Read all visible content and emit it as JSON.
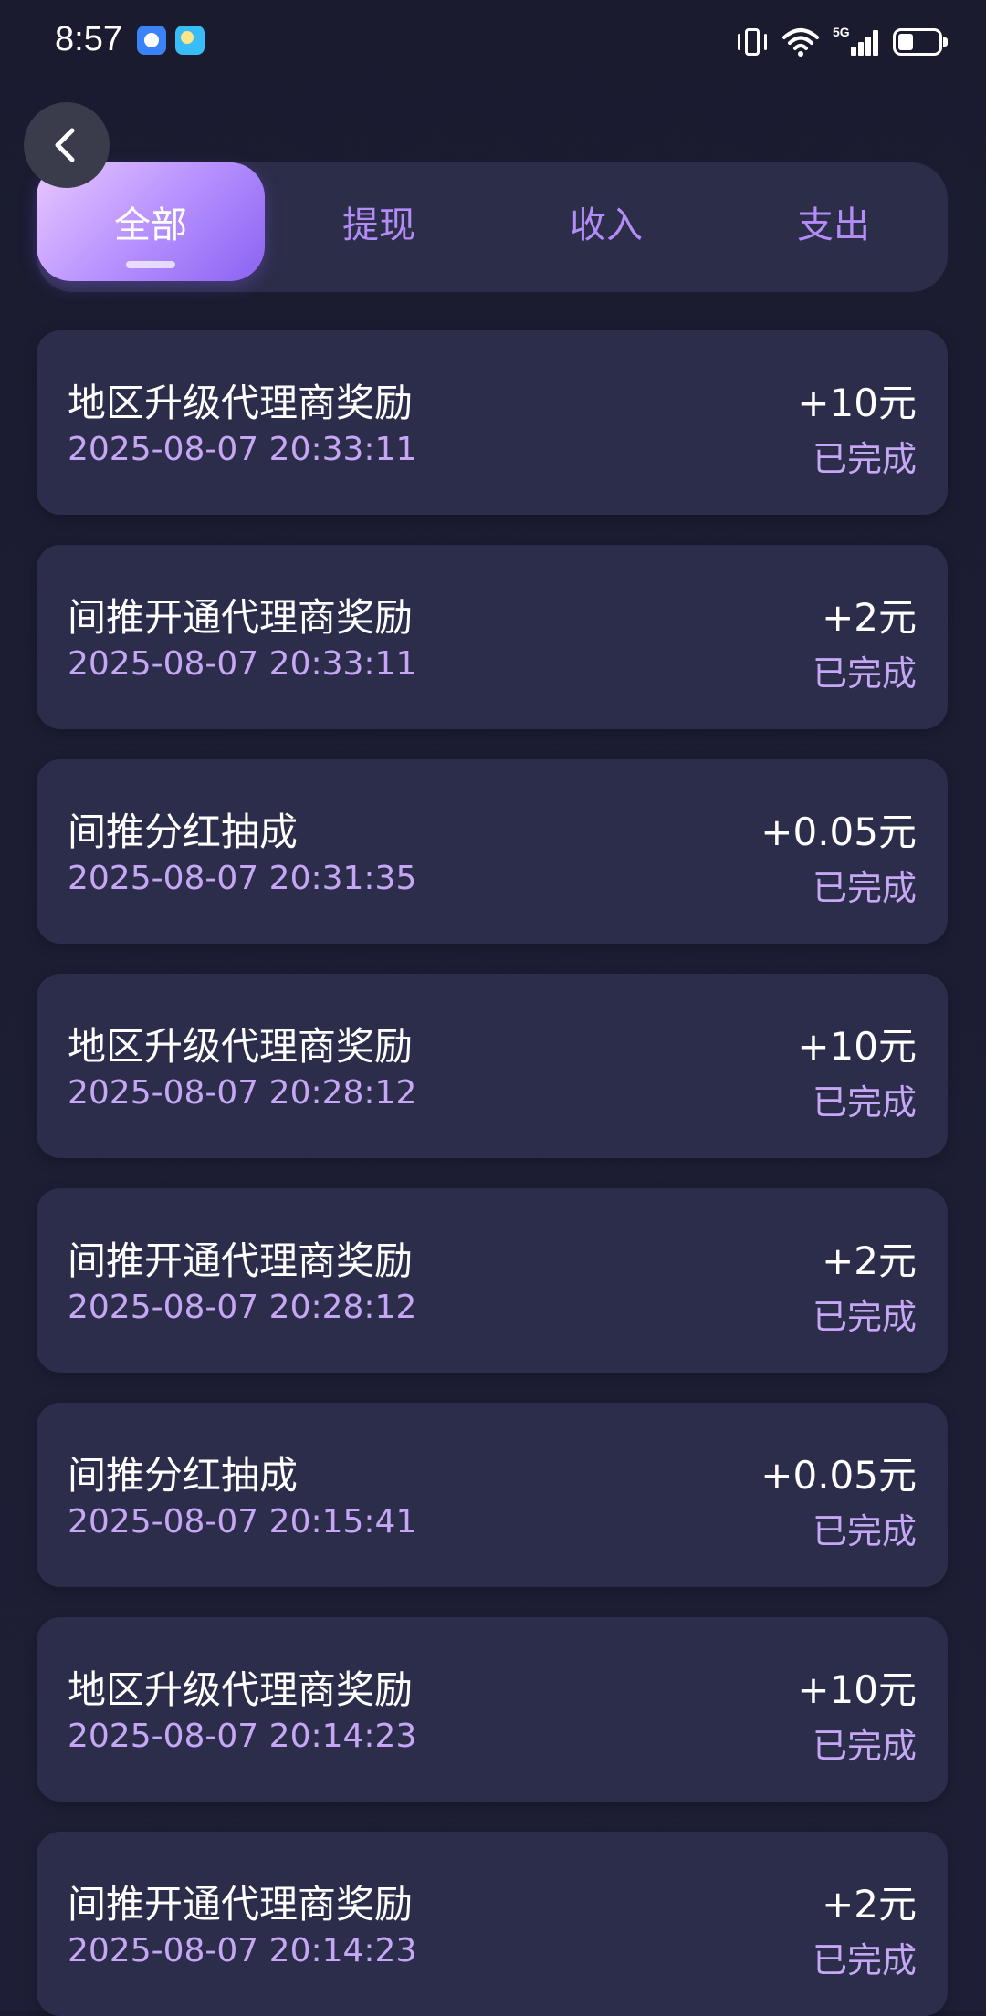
{
  "status_bar": {
    "time": "8:57",
    "network_label": "5G"
  },
  "icons": {
    "back": "chevron-left-icon",
    "vibrate": "vibrate-icon",
    "wifi": "wifi-icon",
    "signal": "signal-icon",
    "battery": "battery-icon"
  },
  "colors": {
    "accent": "#b48cf8",
    "tab_active_start": "#e9c8ff",
    "tab_active_end": "#8a63f2",
    "card_bg": "#2c2d4a",
    "page_bg": "#1a1b2f"
  },
  "tabs": [
    {
      "label": "全部",
      "active": true
    },
    {
      "label": "提现",
      "active": false
    },
    {
      "label": "收入",
      "active": false
    },
    {
      "label": "支出",
      "active": false
    }
  ],
  "records": [
    {
      "title": "地区升级代理商奖励",
      "time": "2025-08-07 20:33:11",
      "amount": "+10元",
      "status": "已完成"
    },
    {
      "title": "间推开通代理商奖励",
      "time": "2025-08-07 20:33:11",
      "amount": "+2元",
      "status": "已完成"
    },
    {
      "title": "间推分红抽成",
      "time": "2025-08-07 20:31:35",
      "amount": "+0.05元",
      "status": "已完成"
    },
    {
      "title": "地区升级代理商奖励",
      "time": "2025-08-07 20:28:12",
      "amount": "+10元",
      "status": "已完成"
    },
    {
      "title": "间推开通代理商奖励",
      "time": "2025-08-07 20:28:12",
      "amount": "+2元",
      "status": "已完成"
    },
    {
      "title": "间推分红抽成",
      "time": "2025-08-07 20:15:41",
      "amount": "+0.05元",
      "status": "已完成"
    },
    {
      "title": "地区升级代理商奖励",
      "time": "2025-08-07 20:14:23",
      "amount": "+10元",
      "status": "已完成"
    },
    {
      "title": "间推开通代理商奖励",
      "time": "2025-08-07 20:14:23",
      "amount": "+2元",
      "status": "已完成"
    }
  ]
}
